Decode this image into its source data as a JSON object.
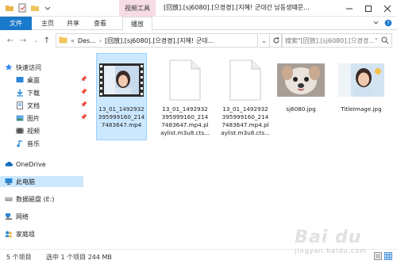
{
  "window": {
    "context_tab": "视频工具",
    "title": "[回放].[sj6080].[으켱켱].[지혜! 군대간 남동생때문..."
  },
  "ribbon": {
    "tabs": [
      "文件",
      "主页",
      "共享",
      "查看",
      "播放"
    ]
  },
  "address": {
    "path": [
      "Des...",
      "[回放].[sj6080].[으켱켱].[지혜! 군대..."
    ],
    "search_placeholder": "搜索\"[回放].[sj6080].[으켱켱...\""
  },
  "sidebar": {
    "items": [
      {
        "label": "快速访问",
        "icon": "star-icon",
        "pinned": false
      },
      {
        "label": "桌面",
        "icon": "desktop-icon",
        "pinned": true
      },
      {
        "label": "下载",
        "icon": "download-icon",
        "pinned": true
      },
      {
        "label": "文档",
        "icon": "document-icon",
        "pinned": true
      },
      {
        "label": "图片",
        "icon": "pictures-icon",
        "pinned": true
      },
      {
        "label": "视频",
        "icon": "video-icon",
        "pinned": false
      },
      {
        "label": "音乐",
        "icon": "music-icon",
        "pinned": false
      },
      {
        "label": "OneDrive",
        "icon": "cloud-icon",
        "pinned": false
      },
      {
        "label": "此电脑",
        "icon": "computer-icon",
        "pinned": false
      },
      {
        "label": "数据磁盘 (E:)",
        "icon": "drive-icon",
        "pinned": false
      },
      {
        "label": "网络",
        "icon": "network-icon",
        "pinned": false
      },
      {
        "label": "家庭组",
        "icon": "homegroup-icon",
        "pinned": false
      }
    ]
  },
  "files": [
    {
      "name": "13_01_1492932395999160_2147483647.mp4",
      "type": "video",
      "selected": true
    },
    {
      "name": "13_01_1492932395999160_2147483647.mp4.playlist.m3u8.cts...",
      "type": "blank",
      "selected": false
    },
    {
      "name": "13_01_1492932395999160_2147483647.mp4.playlist.m3u8.cts...",
      "type": "blank",
      "selected": false
    },
    {
      "name": "sj6080.jpg",
      "type": "image-dog",
      "selected": false
    },
    {
      "name": "TitleImage.jpg",
      "type": "image-person",
      "selected": false
    }
  ],
  "status": {
    "count": "5 个项目",
    "selection": "选中 1 个项目  244 MB"
  },
  "watermark": {
    "brand": "Bai du",
    "sub": "jingyan.baidu.com"
  }
}
